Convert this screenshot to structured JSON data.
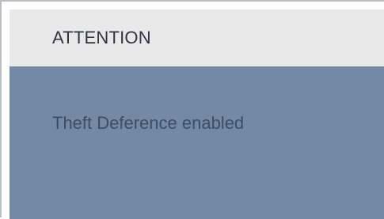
{
  "dialog": {
    "title": "ATTENTION",
    "message": "Theft Deference enabled"
  },
  "colors": {
    "header_background": "#e9e9ea",
    "body_background": "#7489a6",
    "title_text": "#2f3540",
    "message_text": "#3f4d63"
  }
}
